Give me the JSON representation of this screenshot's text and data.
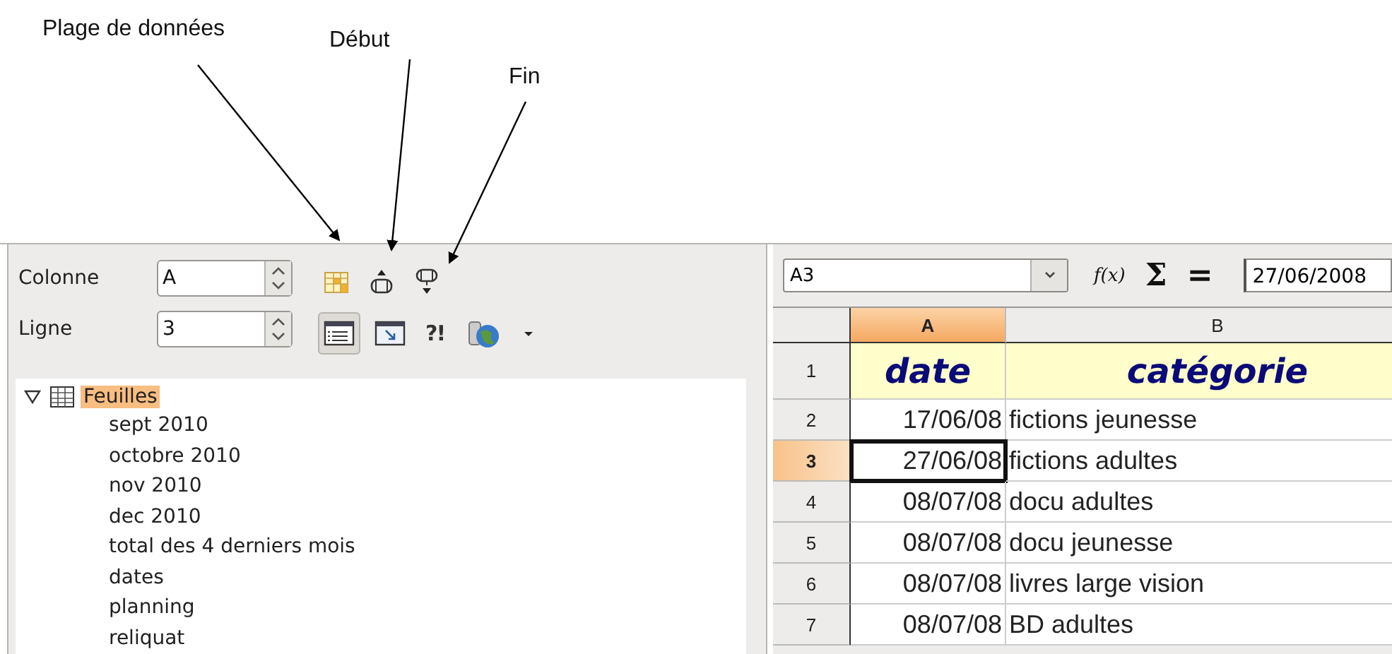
{
  "annotations": [
    {
      "label": "Plage de données"
    },
    {
      "label": "Début"
    },
    {
      "label": "Fin"
    }
  ],
  "navigator": {
    "fields": [
      {
        "label": "Colonne",
        "value": "A"
      },
      {
        "label": "Ligne",
        "value": "3"
      }
    ],
    "toolbar_rows": [
      [
        {
          "kind": "data-range",
          "selected": false
        },
        {
          "kind": "start",
          "selected": false
        },
        {
          "kind": "end",
          "selected": false
        }
      ],
      [
        {
          "kind": "contents",
          "selected": true
        },
        {
          "kind": "scenarios",
          "selected": false
        },
        {
          "kind": "glyph",
          "glyph": "?!",
          "selected": false
        },
        {
          "kind": "drag-mode",
          "selected": false
        },
        {
          "kind": "menu-caret",
          "selected": false
        }
      ]
    ],
    "tree": [
      {
        "label": "Feuilles",
        "expanded": true,
        "selected": true,
        "children": [
          {
            "label": "sept 2010",
            "selected": false
          },
          {
            "label": "octobre 2010",
            "selected": false
          },
          {
            "label": "nov 2010",
            "selected": false
          },
          {
            "label": "dec 2010",
            "selected": false
          },
          {
            "label": "total des 4 derniers mois",
            "selected": false
          },
          {
            "label": "dates",
            "selected": false
          },
          {
            "label": "planning",
            "selected": false
          },
          {
            "label": "reliquat",
            "selected": false
          }
        ]
      }
    ]
  },
  "sheet": {
    "name_box": "A3",
    "formula_icons": [
      "f(x)",
      "Σ",
      "="
    ],
    "formula": "27/06/2008",
    "columns": [
      {
        "label": "A",
        "selected": true
      },
      {
        "label": "B",
        "selected": false
      }
    ],
    "rows": [
      {
        "number": "1",
        "kind": "heading",
        "selected": false,
        "cells": [
          {
            "text": "date",
            "selected": false
          },
          {
            "text": "catégorie",
            "selected": false
          }
        ]
      },
      {
        "number": "2",
        "kind": "data",
        "selected": false,
        "cells": [
          {
            "text": "17/06/08",
            "selected": false
          },
          {
            "text": "fictions jeunesse",
            "selected": false
          }
        ]
      },
      {
        "number": "3",
        "kind": "data",
        "selected": true,
        "cells": [
          {
            "text": "27/06/08",
            "selected": true
          },
          {
            "text": "fictions adultes",
            "selected": false
          }
        ]
      },
      {
        "number": "4",
        "kind": "data",
        "selected": false,
        "cells": [
          {
            "text": "08/07/08",
            "selected": false
          },
          {
            "text": "docu adultes",
            "selected": false
          }
        ]
      },
      {
        "number": "5",
        "kind": "data",
        "selected": false,
        "cells": [
          {
            "text": "08/07/08",
            "selected": false
          },
          {
            "text": "docu jeunesse",
            "selected": false
          }
        ]
      },
      {
        "number": "6",
        "kind": "data",
        "selected": false,
        "cells": [
          {
            "text": "08/07/08",
            "selected": false
          },
          {
            "text": "livres large vision",
            "selected": false
          }
        ]
      },
      {
        "number": "7",
        "kind": "data",
        "selected": false,
        "cells": [
          {
            "text": "08/07/08",
            "selected": false
          },
          {
            "text": "BD adultes",
            "selected": false
          }
        ]
      }
    ]
  }
}
